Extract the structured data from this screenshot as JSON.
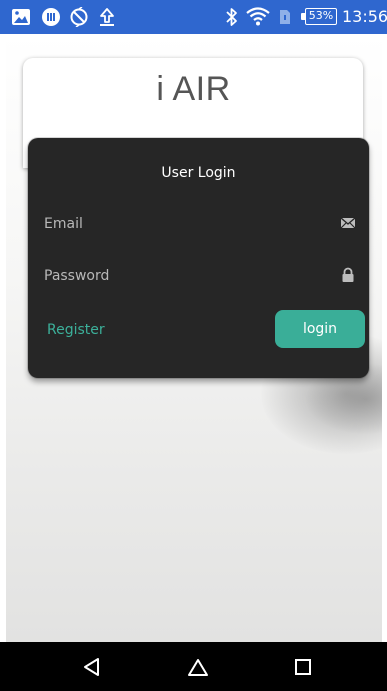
{
  "status_bar": {
    "battery": "53%",
    "time": "13:56",
    "background": "#2f67cf",
    "icons_left": [
      "image-icon",
      "record-icon",
      "blocked-sync-icon",
      "upload-icon"
    ],
    "icons_right": [
      "bluetooth-icon",
      "wifi-icon",
      "sim-icon",
      "battery-icon"
    ]
  },
  "app": {
    "title": "i AIR"
  },
  "login": {
    "title": "User Login",
    "email_placeholder": "Email",
    "email_value": "",
    "password_placeholder": "Password",
    "password_value": "",
    "register_label": "Register",
    "login_label": "login",
    "card_color": "#262626",
    "accent_color": "#3aae98"
  },
  "nav_bar": {
    "buttons": [
      "back-icon",
      "home-icon",
      "recents-icon"
    ]
  }
}
